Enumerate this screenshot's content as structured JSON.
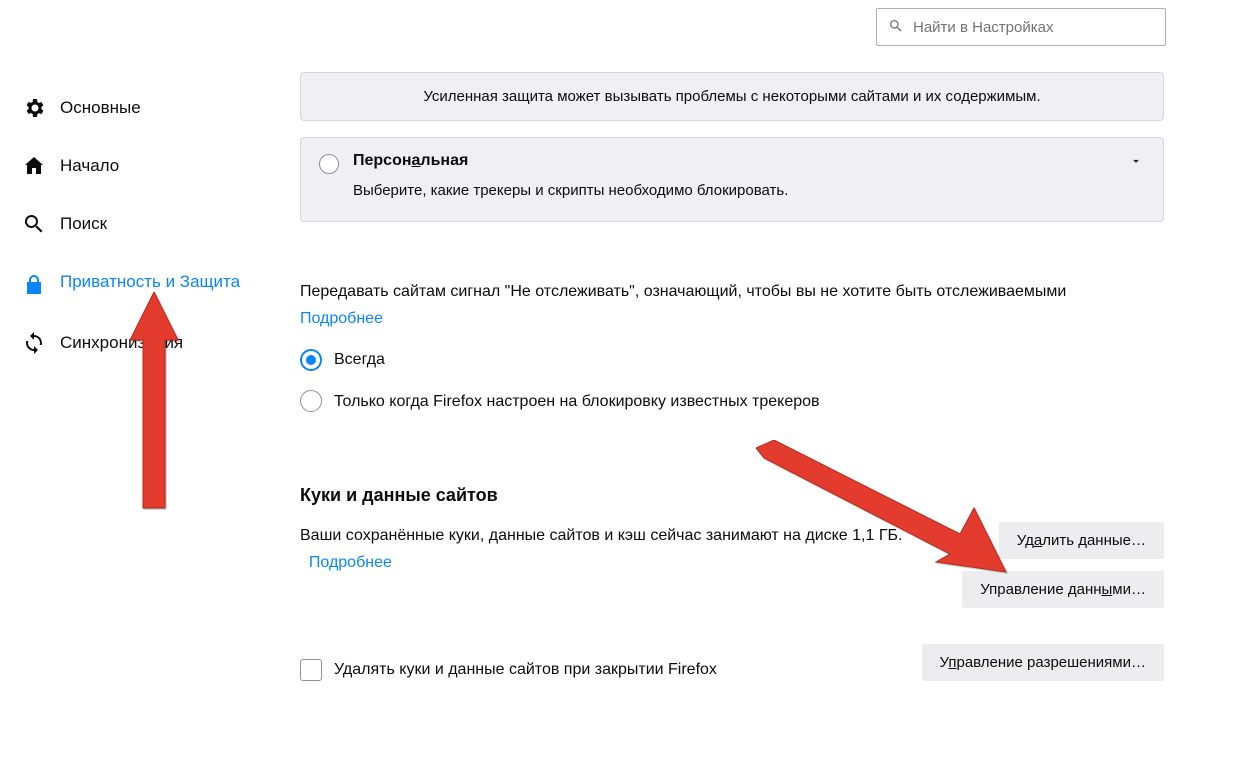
{
  "search": {
    "placeholder": "Найти в Настройках"
  },
  "sidebar": {
    "items": [
      {
        "label": "Основные"
      },
      {
        "label": "Начало"
      },
      {
        "label": "Поиск"
      },
      {
        "label": "Приватность и Защита"
      },
      {
        "label": "Синхронизация"
      }
    ]
  },
  "protection": {
    "warning": "Усиленная защита может вызывать проблемы с некоторыми сайтами и их содержимым.",
    "personal_prefix": "Персон",
    "personal_underlined": "а",
    "personal_suffix": "льная",
    "personal_sub": "Выберите, какие трекеры и скрипты необходимо блокировать."
  },
  "dnt": {
    "text": "Передавать сайтам сигнал \"Не отслеживать\", означающий, чтобы вы не хотите быть отслеживаемыми",
    "more": "Подробнее",
    "always": "Всегда",
    "only_when": "Только когда Firefox настроен на блокировку известных трекеров"
  },
  "cookies": {
    "heading": "Куки и данные сайтов",
    "stored_prefix": "Ваши сохранённые куки, данные сайтов и кэш сейчас занимают на диске ",
    "size": "1,1 ГБ.",
    "more": "Подробнее",
    "delete_data_pre": "Уд",
    "delete_data_u": "а",
    "delete_data_post": "лить данные…",
    "manage_data_pre": "Управление данн",
    "manage_data_u": "ы",
    "manage_data_post": "ми…",
    "manage_perm_pre": "У",
    "manage_perm_u": "п",
    "manage_perm_post": "равление разрешениями…",
    "delete_on_close": "Удалять куки и данные сайтов при закрытии Firefox"
  }
}
